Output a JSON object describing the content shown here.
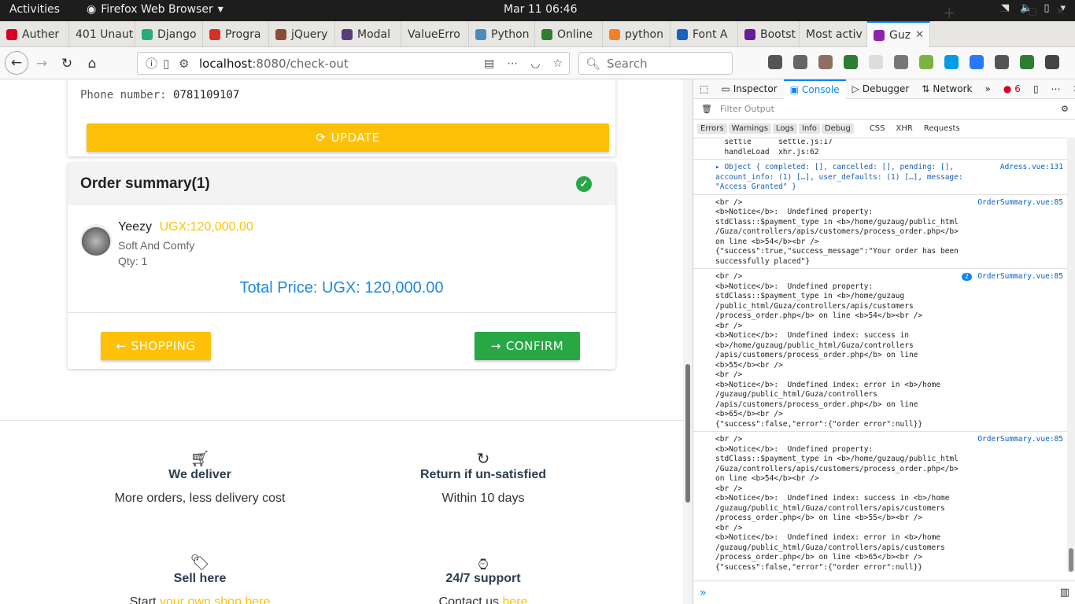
{
  "gnome": {
    "activities": "Activities",
    "app": "Firefox Web Browser",
    "clock": "Mar 11  06:46",
    "tray": [
      "wifi-icon",
      "volume-icon",
      "battery-icon",
      "power-icon"
    ]
  },
  "tabs": [
    {
      "label": "Auther",
      "color": "#d70022"
    },
    {
      "label": "401 Unaut",
      "color": ""
    },
    {
      "label": "Django",
      "color": "#2ba977"
    },
    {
      "label": "Progra",
      "color": "#d93025"
    },
    {
      "label": "jQuery",
      "color": "#8a4b38"
    },
    {
      "label": "Modal",
      "color": "#563d7c"
    },
    {
      "label": "ValueErro",
      "color": ""
    },
    {
      "label": "Python",
      "color": "#4b8bbe"
    },
    {
      "label": "Online",
      "color": "#2e7d32"
    },
    {
      "label": "python",
      "color": "#f48024"
    },
    {
      "label": "Font A",
      "color": "#1565c0"
    },
    {
      "label": "Bootst",
      "color": "#6a1b9a"
    },
    {
      "label": "Most activ",
      "color": ""
    },
    {
      "label": "Guz",
      "color": "#8e24aa"
    }
  ],
  "nav": {
    "url_host": "localhost",
    "url_path": ":8080/check-out",
    "search_placeholder": "Search"
  },
  "page": {
    "phone_label": "Phone number:",
    "phone_value": "0781109107",
    "update_label": "UPDATE",
    "summary_title": "Order summary(1)",
    "item_name": "Yeezy",
    "item_price": "UGX:120,000.00",
    "item_desc": "Soft And Comfy",
    "item_qty": "Qty: 1",
    "total": "Total Price: UGX: 120,000.00",
    "shopping_label": "SHOPPING",
    "confirm_label": "CONFIRM",
    "features": [
      {
        "title": "We deliver",
        "sub": "More orders, less delivery cost"
      },
      {
        "title": "Return if un-satisfied",
        "sub": "Within 10 days"
      },
      {
        "title": "Sell here",
        "sub_a": "Start ",
        "sub_link": "your own shop here"
      },
      {
        "title": "24/7 support",
        "sub_a": "Contact us ",
        "sub_link": "here"
      }
    ],
    "colors": {
      "accent": "#ffc107",
      "success": "#28a745",
      "link": "#1e88e5"
    }
  },
  "devtools": {
    "tabs": [
      "Inspector",
      "Console",
      "Debugger",
      "Network"
    ],
    "error_count": "6",
    "filter_placeholder": "Filter Output",
    "levels": [
      "Errors",
      "Warnings",
      "Logs",
      "Info",
      "Debug"
    ],
    "types": [
      "CSS",
      "XHR",
      "Requests"
    ],
    "messages": [
      {
        "text": "  settle      settle.js:17\n  handleLoad  xhr.js:62",
        "src": "",
        "count": ""
      },
      {
        "text": "▸ Object { completed: [], cancelled: [], pending: [],\naccount_info: (1) […], user_defaults: (1) […], message:\n\"Access Granted\" }",
        "src": "Adress.vue:131",
        "count": ""
      },
      {
        "text": "<br />\n<b>Notice</b>:  Undefined property:\nstdClass::$payment_type in <b>/home/guzaug/public_html\n/Guza/controllers/apis/customers/process_order.php</b>\non line <b>54</b><br />\n{\"success\":true,\"success_message\":\"Your order has been\nsuccessfully placed\"}",
        "src": "OrderSummary.vue:85",
        "count": ""
      },
      {
        "text": "<br />\n<b>Notice</b>:  Undefined property:\nstdClass::$payment_type in <b>/home/guzaug\n/public_html/Guza/controllers/apis/customers\n/process_order.php</b> on line <b>54</b><br />\n<br />\n<b>Notice</b>:  Undefined index: success in\n<b>/home/guzaug/public_html/Guza/controllers\n/apis/customers/process_order.php</b> on line\n<b>55</b><br />\n<br />\n<b>Notice</b>:  Undefined index: error in <b>/home\n/guzaug/public_html/Guza/controllers\n/apis/customers/process_order.php</b> on line\n<b>65</b><br />\n{\"success\":false,\"error\":{\"order error\":null}}",
        "src": "OrderSummary.vue:85",
        "count": "2"
      },
      {
        "text": "<br />\n<b>Notice</b>:  Undefined property:\nstdClass::$payment_type in <b>/home/guzaug/public_html\n/Guza/controllers/apis/customers/process_order.php</b>\non line <b>54</b><br />\n<br />\n<b>Notice</b>:  Undefined index: success in <b>/home\n/guzaug/public_html/Guza/controllers/apis/customers\n/process_order.php</b> on line <b>55</b><br />\n<br />\n<b>Notice</b>:  Undefined index: error in <b>/home\n/guzaug/public_html/Guza/controllers/apis/customers\n/process_order.php</b> on line <b>65</b><br />\n{\"success\":false,\"error\":{\"order error\":null}}",
        "src": "OrderSummary.vue:85",
        "count": ""
      }
    ]
  }
}
